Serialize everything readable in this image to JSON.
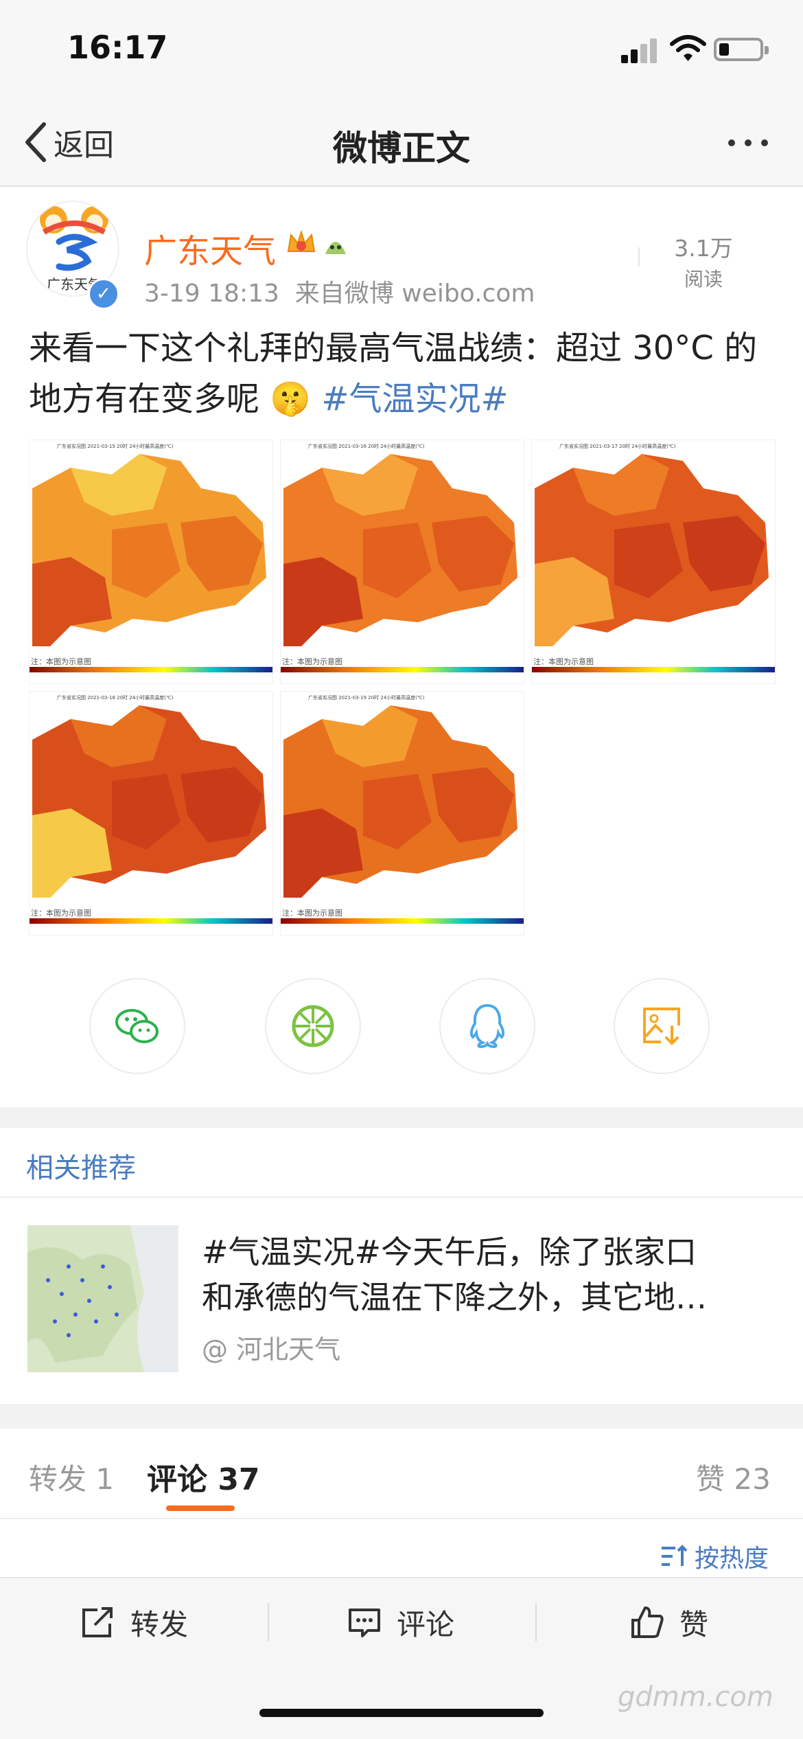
{
  "status_bar": {
    "time": "16:17"
  },
  "nav": {
    "back_label": "返回",
    "title": "微博正文"
  },
  "post": {
    "author": "广东天气",
    "avatar_text": "广东天气",
    "time": "3-19 18:13",
    "source": "来自微博 weibo.com",
    "reads_count": "3.1万",
    "reads_label": "阅读",
    "text_main": "来看一下这个礼拜的最高气温战绩：超过 30°C 的地方有在变多呢",
    "emoji": "🤫",
    "hashtag": "#气温实况#"
  },
  "images": [
    {
      "title": "广东省实况图 2021-03-15 20时 24小时最高温度(℃)",
      "note": "注：本图为示意图"
    },
    {
      "title": "广东省实况图 2021-03-16 20时 24小时最高温度(℃)",
      "note": "注：本图为示意图"
    },
    {
      "title": "广东省实况图 2021-03-17 20时 24小时最高温度(℃)",
      "note": "注：本图为示意图"
    },
    {
      "title": "广东省实况图 2021-03-18 20时 24小时最高温度(℃)",
      "note": "注：本图为示意图"
    },
    {
      "title": "广东省实况图 2021-03-19 20时 24小时最高温度(℃)",
      "note": "注：本图为示意图"
    }
  ],
  "share": [
    {
      "name": "wechat",
      "icon": "wechat-icon"
    },
    {
      "name": "moments",
      "icon": "moments-icon"
    },
    {
      "name": "qq",
      "icon": "qq-icon"
    },
    {
      "name": "save-image",
      "icon": "save-image-icon"
    }
  ],
  "related": {
    "title": "相关推荐",
    "item_line1": "#气温实况#今天午后，除了张家口",
    "item_line2": "和承德的气温在下降之外，其它地…",
    "item_source": "@ 河北天气"
  },
  "tabs": {
    "forward": "转发 1",
    "comments": "评论 37",
    "likes": "赞 23"
  },
  "sort_label": "按热度",
  "toolbar": {
    "forward": "转发",
    "comment": "评论",
    "like": "赞"
  },
  "watermark": "gdmm.com",
  "colors": {
    "accent": "#f86c1f",
    "link": "#4a7cc0"
  }
}
